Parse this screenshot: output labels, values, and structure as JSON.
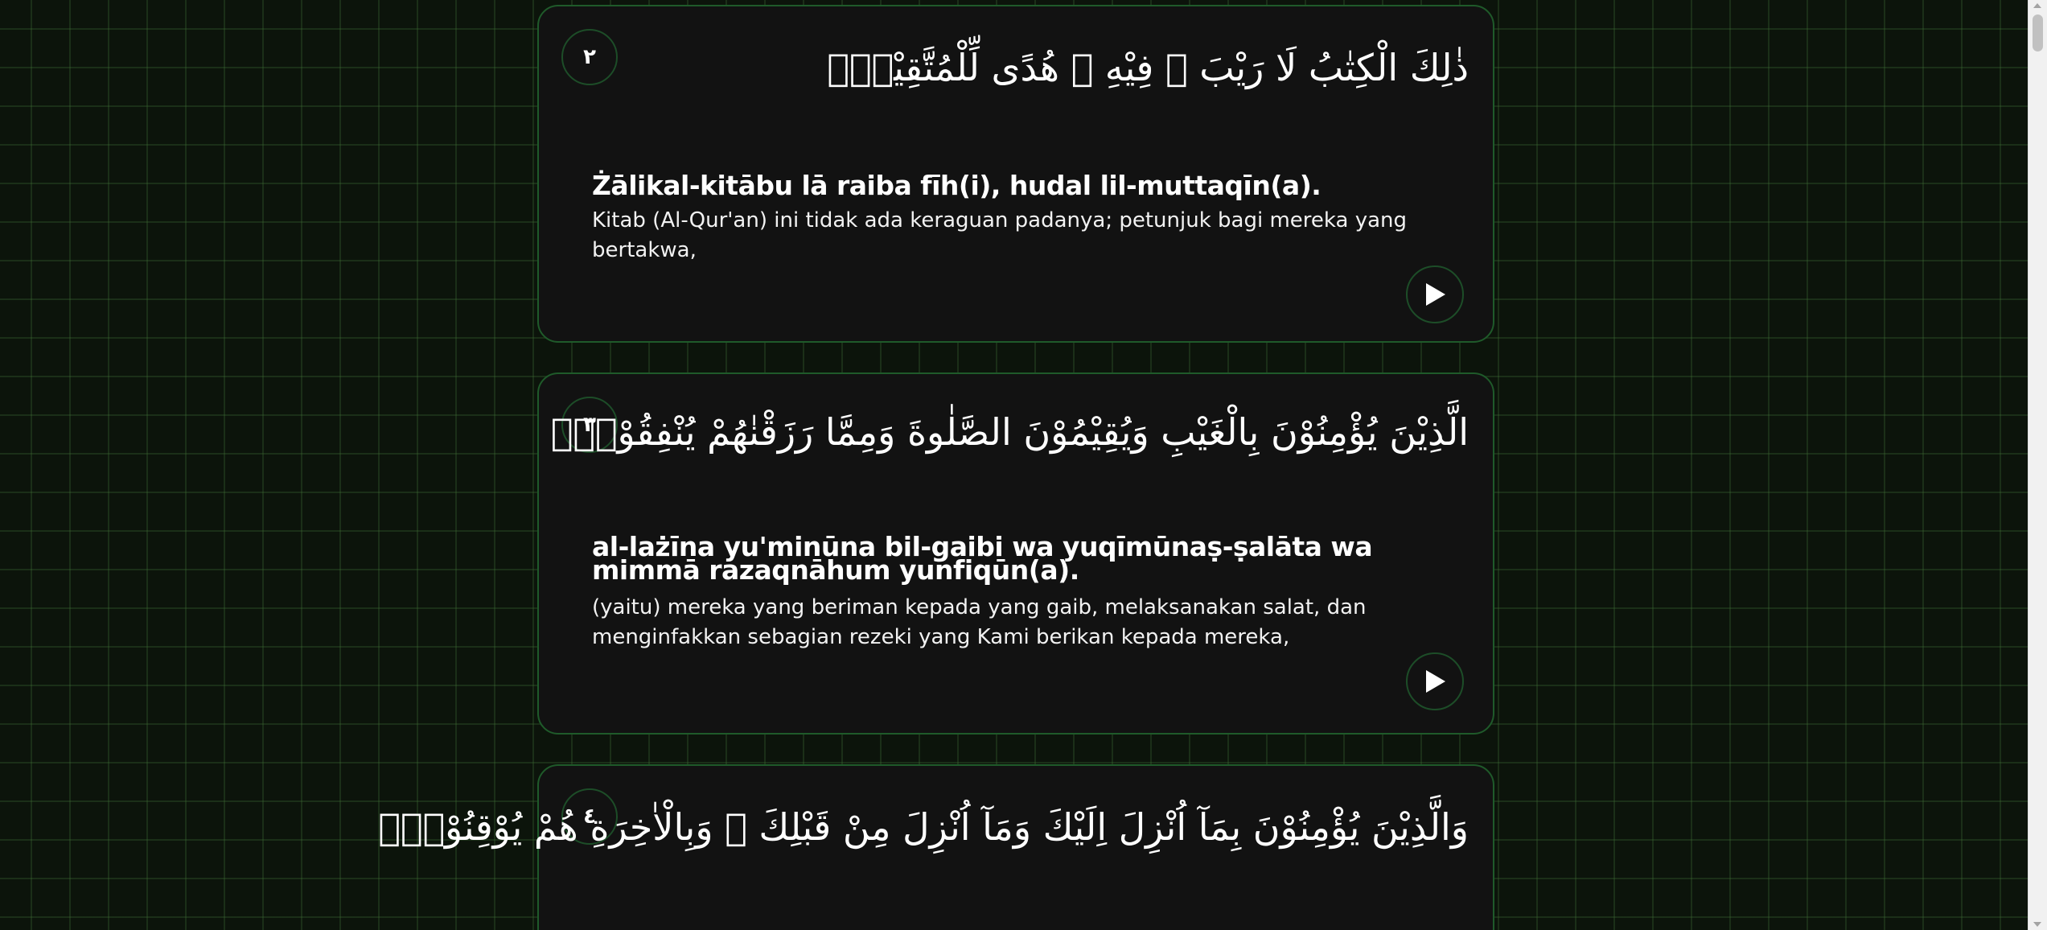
{
  "verses": [
    {
      "number": "٢",
      "arabic": "ذٰلِكَ الْكِتٰبُ لَا رَيْبَ ۛ فِيْهِ ۛ هُدًى لِّلْمُتَّقِيْنَۙ",
      "latin": "Żālikal-kitābu lā raiba fīh(i), hudal lil-muttaqīn(a).",
      "translation": "Kitab (Al-Qur'an) ini tidak ada keraguan padanya; petunjuk bagi mereka yang bertakwa,",
      "play_icon": "play-icon"
    },
    {
      "number": "٣",
      "arabic": "الَّذِيْنَ يُؤْمِنُوْنَ بِالْغَيْبِ وَيُقِيْمُوْنَ الصَّلٰوةَ وَمِمَّا رَزَقْنٰهُمْ يُنْفِقُوْنَۙ",
      "latin": "al-lażīna yu'minūna bil-gaibi wa yuqīmūnaṣ-ṣalāta wa mimmā razaqnāhum yunfiqūn(a).",
      "translation": "(yaitu) mereka yang beriman kepada yang gaib, melaksanakan salat, dan menginfakkan sebagian rezeki yang Kami berikan kepada mereka,",
      "play_icon": "play-icon"
    },
    {
      "number": "٤",
      "arabic": "وَالَّذِيْنَ يُؤْمِنُوْنَ بِمَآ اُنْزِلَ اِلَيْكَ وَمَآ اُنْزِلَ مِنْ قَبْلِكَ ۚ وَبِالْاٰخِرَةِ هُمْ يُوْقِنُوْنَۗ"
    }
  ],
  "colors": {
    "background": "#0c140b",
    "card": "#121212",
    "card_border": "#1f5a2a",
    "text": "#ffffff"
  }
}
